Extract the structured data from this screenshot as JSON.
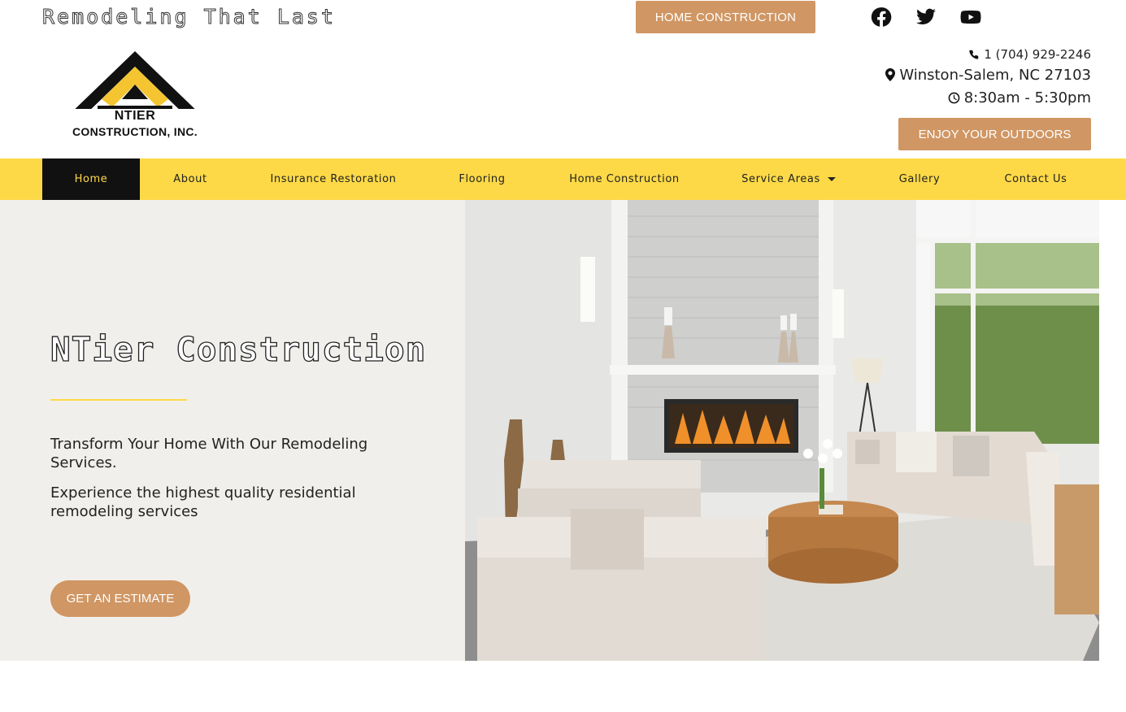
{
  "header": {
    "tagline": "Remodeling That Last",
    "top_button": "HOME CONSTRUCTION",
    "social": [
      "facebook-icon",
      "twitter-icon",
      "youtube-icon"
    ]
  },
  "logo": {
    "line1": "NTIER",
    "line2": "CONSTRUCTION, INC."
  },
  "contact": {
    "phone": "1 (704) 929-2246",
    "address": "Winston-Salem, NC 27103",
    "hours": "8:30am - 5:30pm",
    "cta": "ENJOY YOUR OUTDOORS"
  },
  "nav": {
    "items": [
      {
        "label": "Home"
      },
      {
        "label": "About"
      },
      {
        "label": "Insurance Restoration"
      },
      {
        "label": "Flooring"
      },
      {
        "label": "Home Construction"
      },
      {
        "label": "Service Areas"
      },
      {
        "label": "Gallery"
      },
      {
        "label": "Contact Us"
      }
    ]
  },
  "hero": {
    "title": "NTier Construction",
    "paragraph1": "Transform Your Home With Our Remodeling Services.",
    "paragraph2": "Experience the highest quality residential remodeling services",
    "button": "GET AN ESTIMATE"
  },
  "colors": {
    "accent": "#d09663",
    "nav_bg": "#fdd947",
    "active_bg": "#111111",
    "hero_bg": "#f1efeb"
  }
}
